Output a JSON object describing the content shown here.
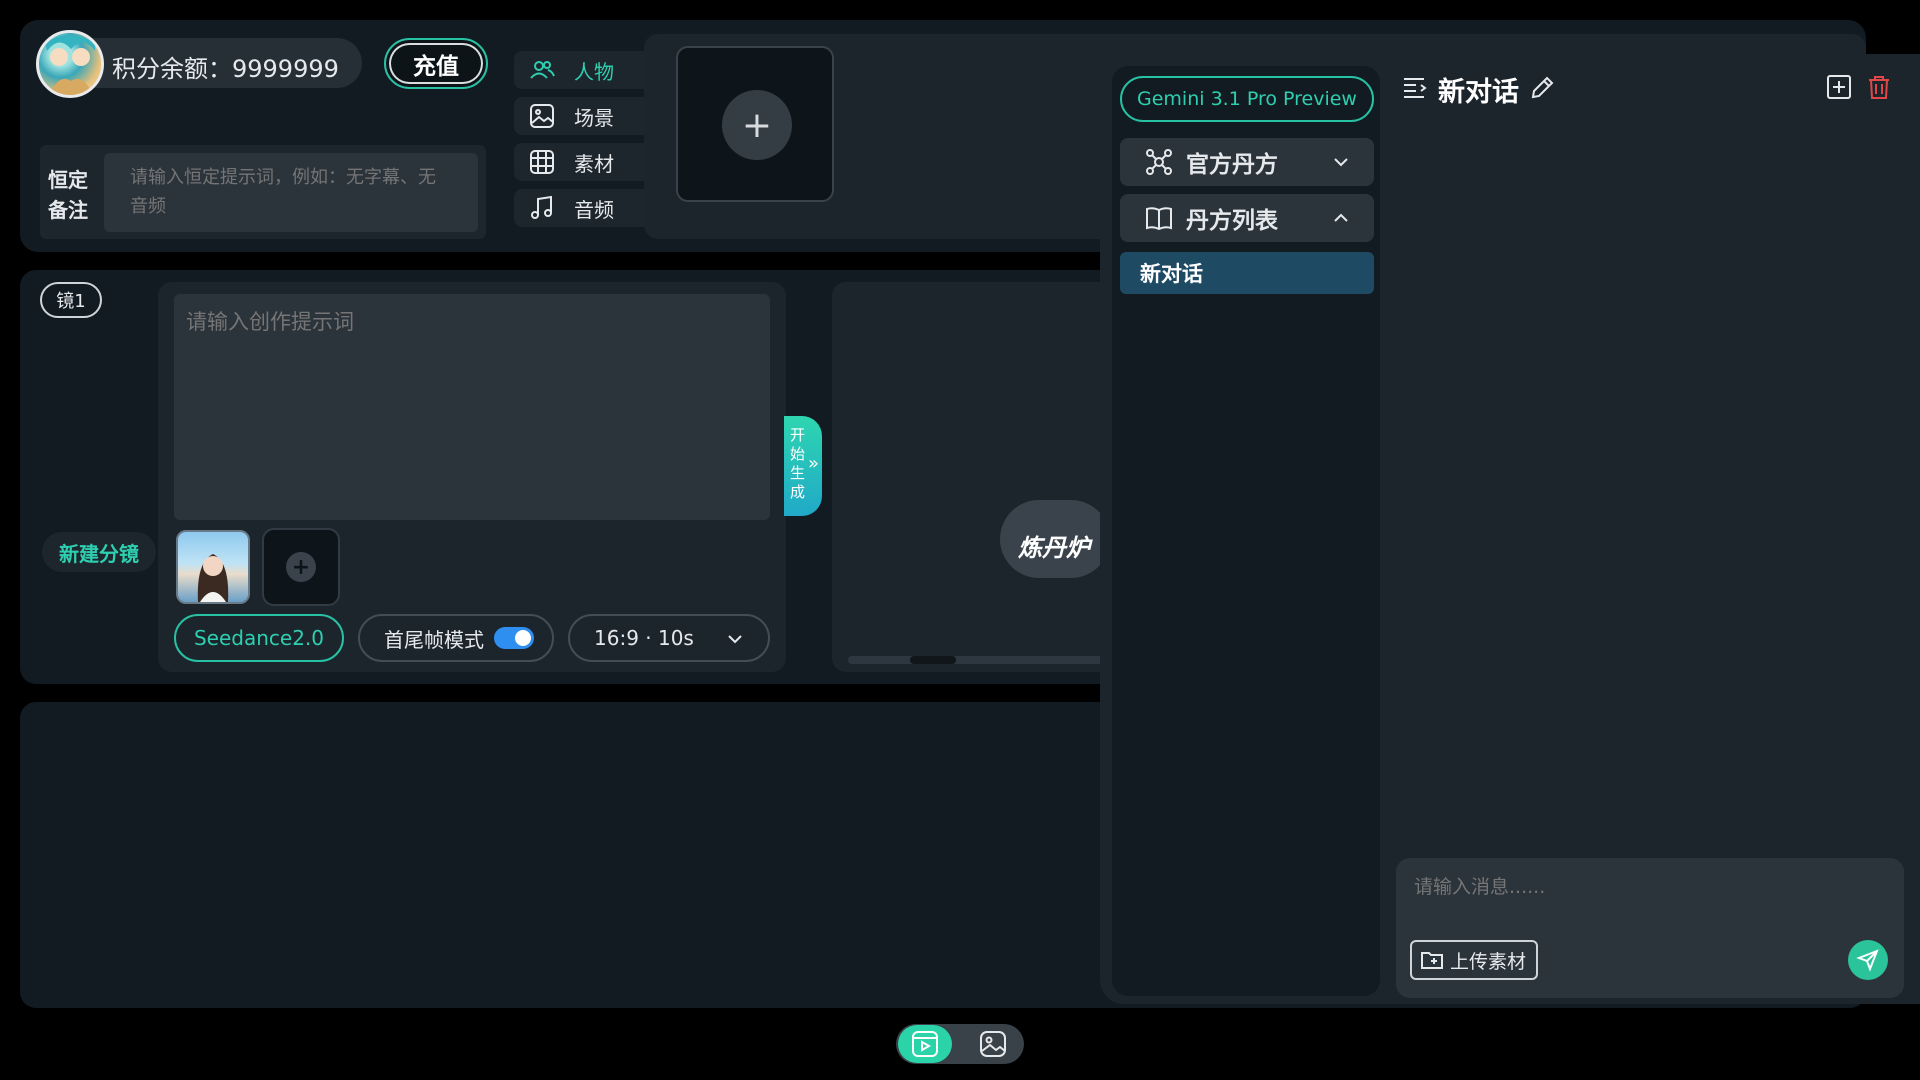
{
  "header": {
    "points_label": "积分余额：9999999",
    "recharge_label": "充值",
    "memo_label": "恒定备注",
    "memo_placeholder": "请输入恒定提示词，例如：无字幕、无音频"
  },
  "categories": [
    {
      "label": "人物",
      "icon": "people-icon",
      "active": true
    },
    {
      "label": "场景",
      "icon": "image-icon",
      "active": false
    },
    {
      "label": "素材",
      "icon": "grid-icon",
      "active": false
    },
    {
      "label": "音频",
      "icon": "music-icon",
      "active": false
    }
  ],
  "assets": {
    "add_symbol": "+"
  },
  "shot": {
    "tag": "镜1",
    "new_shot_label": "新建分镜",
    "prompt_placeholder": "请输入创作提示词",
    "model": "Seedance2.0",
    "mode_label": "首尾帧模式",
    "mode_enabled": true,
    "ratio_duration": "16:9 · 10s",
    "generate_label": "开始生成",
    "generate_arrow": "»"
  },
  "preview": {
    "logo_text": "炼丹炉"
  },
  "chat": {
    "model_button": "Gemini 3.1 Pro Preview",
    "official_section": "官方丹方",
    "list_section": "丹方列表",
    "conversations": [
      "新对话"
    ],
    "title": "新对话",
    "message_placeholder": "请输入消息......",
    "upload_label": "上传素材"
  },
  "colors": {
    "accent": "#2ecfb0",
    "panel": "#131b22",
    "card": "#1d252c",
    "active_item": "#1f4a64",
    "delete": "#e04848"
  }
}
